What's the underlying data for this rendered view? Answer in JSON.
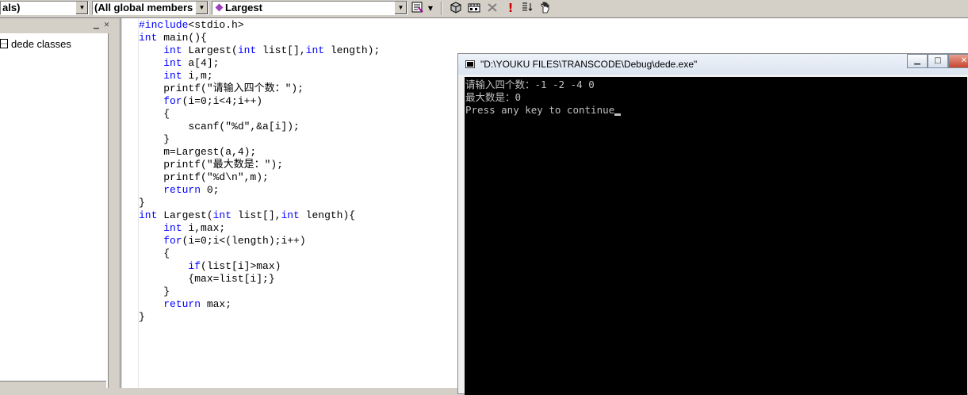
{
  "toolbar": {
    "class_combo": "als)",
    "members_combo": "(All global members",
    "function_combo": "Largest",
    "icons": [
      "wizard-bar-actions-icon",
      "compile-icon",
      "build-icon",
      "stop-build-icon",
      "execute-icon",
      "step-into-icon",
      "insert-breakpoint-icon"
    ]
  },
  "classview": {
    "root": "dede classes"
  },
  "editor": {
    "lines": [
      [
        [
          "#include",
          "kw"
        ],
        [
          "<stdio.h>",
          ""
        ]
      ],
      [
        [
          "int",
          "kw"
        ],
        [
          " main(){",
          ""
        ]
      ],
      [
        [
          "    ",
          ""
        ],
        [
          "int",
          "kw"
        ],
        [
          " Largest(",
          ""
        ],
        [
          "int",
          "kw"
        ],
        [
          " list[],",
          ""
        ],
        [
          "int",
          "kw"
        ],
        [
          " length);",
          ""
        ]
      ],
      [
        [
          "    ",
          ""
        ],
        [
          "int",
          "kw"
        ],
        [
          " a[4];",
          ""
        ]
      ],
      [
        [
          "    ",
          ""
        ],
        [
          "int",
          "kw"
        ],
        [
          " i,m;",
          ""
        ]
      ],
      [
        [
          "    printf(\"请输入四个数：\");",
          ""
        ]
      ],
      [
        [
          "    ",
          ""
        ],
        [
          "for",
          "kw"
        ],
        [
          "(i=0;i<4;i++)",
          ""
        ]
      ],
      [
        [
          "    {",
          ""
        ]
      ],
      [
        [
          "        scanf(\"%d\",&a[i]);",
          ""
        ]
      ],
      [
        [
          "    }",
          ""
        ]
      ],
      [
        [
          "    m=Largest(a,4);",
          ""
        ]
      ],
      [
        [
          "    printf(\"最大数是：\");",
          ""
        ]
      ],
      [
        [
          "    printf(\"%d\\n\",m);",
          ""
        ]
      ],
      [
        [
          "    ",
          ""
        ],
        [
          "return",
          "kw"
        ],
        [
          " 0;",
          ""
        ]
      ],
      [
        [
          "}",
          ""
        ]
      ],
      [
        [
          "int",
          "kw"
        ],
        [
          " Largest(",
          ""
        ],
        [
          "int",
          "kw"
        ],
        [
          " list[],",
          ""
        ],
        [
          "int",
          "kw"
        ],
        [
          " length){",
          ""
        ]
      ],
      [
        [
          "    ",
          ""
        ],
        [
          "int",
          "kw"
        ],
        [
          " i,max;",
          ""
        ]
      ],
      [
        [
          "    ",
          ""
        ],
        [
          "for",
          "kw"
        ],
        [
          "(i=0;i<(length);i++)",
          ""
        ]
      ],
      [
        [
          "    {",
          ""
        ]
      ],
      [
        [
          "        ",
          ""
        ],
        [
          "if",
          "kw"
        ],
        [
          "(list[i]>max)",
          ""
        ]
      ],
      [
        [
          "        {max=list[i];}",
          ""
        ]
      ],
      [
        [
          "    }",
          ""
        ]
      ],
      [
        [
          "    ",
          ""
        ],
        [
          "return",
          "kw"
        ],
        [
          " max;",
          ""
        ]
      ],
      [
        [
          "}",
          ""
        ]
      ]
    ]
  },
  "console": {
    "title": "\"D:\\YOUKU FILES\\TRANSCODE\\Debug\\dede.exe\"",
    "line1": "请输入四个数：-1 -2 -4 0",
    "line2": "最大数是：0",
    "line3": "Press any key to continue"
  },
  "colors": {
    "keyword": "#0000ff",
    "console_bg": "#000000",
    "console_fg": "#c0c0c0"
  }
}
